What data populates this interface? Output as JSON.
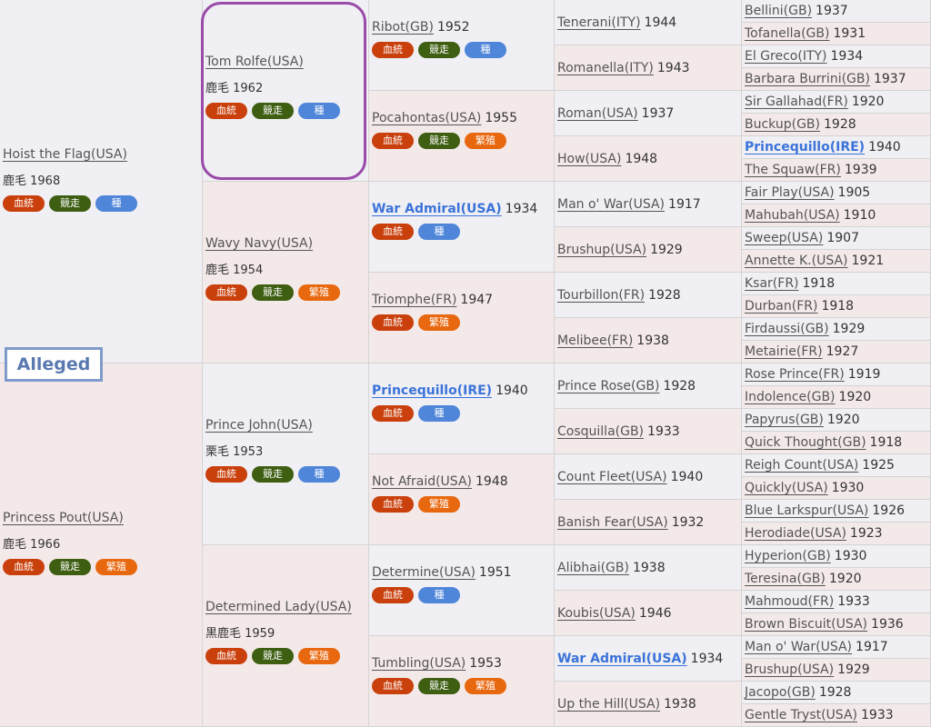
{
  "subject": "Alleged",
  "badges": {
    "ketto": "血統",
    "kyoso": "競走",
    "tane": "種",
    "hanshoku": "繁殖"
  },
  "gen1": [
    {
      "name": "Hoist the Flag(USA)",
      "color": "鹿毛 1968",
      "badges": [
        "ketto",
        "kyoso",
        "tane"
      ]
    },
    {
      "name": "Princess Pout(USA)",
      "color": "鹿毛 1966",
      "badges": [
        "ketto",
        "kyoso",
        "hanshoku"
      ]
    }
  ],
  "gen2": [
    {
      "name": "Tom Rolfe(USA)",
      "color": "鹿毛 1962",
      "badges": [
        "ketto",
        "kyoso",
        "tane"
      ]
    },
    {
      "name": "Wavy Navy(USA)",
      "color": "鹿毛 1954",
      "badges": [
        "ketto",
        "kyoso",
        "hanshoku"
      ]
    },
    {
      "name": "Prince John(USA)",
      "color": "栗毛 1953",
      "badges": [
        "ketto",
        "kyoso",
        "tane"
      ]
    },
    {
      "name": "Determined Lady(USA)",
      "color": "黒鹿毛 1959",
      "badges": [
        "ketto",
        "kyoso",
        "hanshoku"
      ]
    }
  ],
  "gen3": [
    {
      "name": "Ribot(GB)",
      "year": "1952",
      "badges": [
        "ketto",
        "kyoso",
        "tane"
      ]
    },
    {
      "name": "Pocahontas(USA)",
      "year": "1955",
      "badges": [
        "ketto",
        "kyoso",
        "hanshoku"
      ]
    },
    {
      "name": "War Admiral(USA)",
      "year": "1934",
      "badges": [
        "ketto",
        "tane"
      ],
      "bold": true
    },
    {
      "name": "Triomphe(FR)",
      "year": "1947",
      "badges": [
        "ketto",
        "hanshoku"
      ]
    },
    {
      "name": "Princequillo(IRE)",
      "year": "1940",
      "badges": [
        "ketto",
        "tane"
      ],
      "bold": true
    },
    {
      "name": "Not Afraid(USA)",
      "year": "1948",
      "badges": [
        "ketto",
        "hanshoku"
      ]
    },
    {
      "name": "Determine(USA)",
      "year": "1951",
      "badges": [
        "ketto",
        "tane"
      ]
    },
    {
      "name": "Tumbling(USA)",
      "year": "1953",
      "badges": [
        "ketto",
        "kyoso",
        "hanshoku"
      ]
    }
  ],
  "gen4": [
    {
      "name": "Tenerani(ITY)",
      "year": "1944"
    },
    {
      "name": "Romanella(ITY)",
      "year": "1943"
    },
    {
      "name": "Roman(USA)",
      "year": "1937"
    },
    {
      "name": "How(USA)",
      "year": "1948"
    },
    {
      "name": "Man o' War(USA)",
      "year": "1917"
    },
    {
      "name": "Brushup(USA)",
      "year": "1929"
    },
    {
      "name": "Tourbillon(FR)",
      "year": "1928"
    },
    {
      "name": "Melibee(FR)",
      "year": "1938"
    },
    {
      "name": "Prince Rose(GB)",
      "year": "1928"
    },
    {
      "name": "Cosquilla(GB)",
      "year": "1933"
    },
    {
      "name": "Count Fleet(USA)",
      "year": "1940"
    },
    {
      "name": "Banish Fear(USA)",
      "year": "1932"
    },
    {
      "name": "Alibhai(GB)",
      "year": "1938"
    },
    {
      "name": "Koubis(USA)",
      "year": "1946"
    },
    {
      "name": "War Admiral(USA)",
      "year": "1934",
      "bold": true
    },
    {
      "name": "Up the Hill(USA)",
      "year": "1938"
    }
  ],
  "gen5": [
    {
      "name": "Bellini(GB)",
      "year": "1937"
    },
    {
      "name": "Tofanella(GB)",
      "year": "1931"
    },
    {
      "name": "El Greco(ITY)",
      "year": "1934"
    },
    {
      "name": "Barbara Burrini(GB)",
      "year": "1937"
    },
    {
      "name": "Sir Gallahad(FR)",
      "year": "1920"
    },
    {
      "name": "Buckup(GB)",
      "year": "1928"
    },
    {
      "name": "Princequillo(IRE)",
      "year": "1940",
      "bold": true
    },
    {
      "name": "The Squaw(FR)",
      "year": "1939"
    },
    {
      "name": "Fair Play(USA)",
      "year": "1905"
    },
    {
      "name": "Mahubah(USA)",
      "year": "1910"
    },
    {
      "name": "Sweep(USA)",
      "year": "1907"
    },
    {
      "name": "Annette K.(USA)",
      "year": "1921"
    },
    {
      "name": "Ksar(FR)",
      "year": "1918"
    },
    {
      "name": "Durban(FR)",
      "year": "1918"
    },
    {
      "name": "Firdaussi(GB)",
      "year": "1929"
    },
    {
      "name": "Metairie(FR)",
      "year": "1927"
    },
    {
      "name": "Rose Prince(FR)",
      "year": "1919"
    },
    {
      "name": "Indolence(GB)",
      "year": "1920"
    },
    {
      "name": "Papyrus(GB)",
      "year": "1920"
    },
    {
      "name": "Quick Thought(GB)",
      "year": "1918"
    },
    {
      "name": "Reigh Count(USA)",
      "year": "1925"
    },
    {
      "name": "Quickly(USA)",
      "year": "1930"
    },
    {
      "name": "Blue Larkspur(USA)",
      "year": "1926"
    },
    {
      "name": "Herodiade(USA)",
      "year": "1923"
    },
    {
      "name": "Hyperion(GB)",
      "year": "1930"
    },
    {
      "name": "Teresina(GB)",
      "year": "1920"
    },
    {
      "name": "Mahmoud(FR)",
      "year": "1933"
    },
    {
      "name": "Brown Biscuit(USA)",
      "year": "1936"
    },
    {
      "name": "Man o' War(USA)",
      "year": "1917"
    },
    {
      "name": "Brushup(USA)",
      "year": "1929"
    },
    {
      "name": "Jacopo(GB)",
      "year": "1928"
    },
    {
      "name": "Gentle Tryst(USA)",
      "year": "1933"
    }
  ]
}
